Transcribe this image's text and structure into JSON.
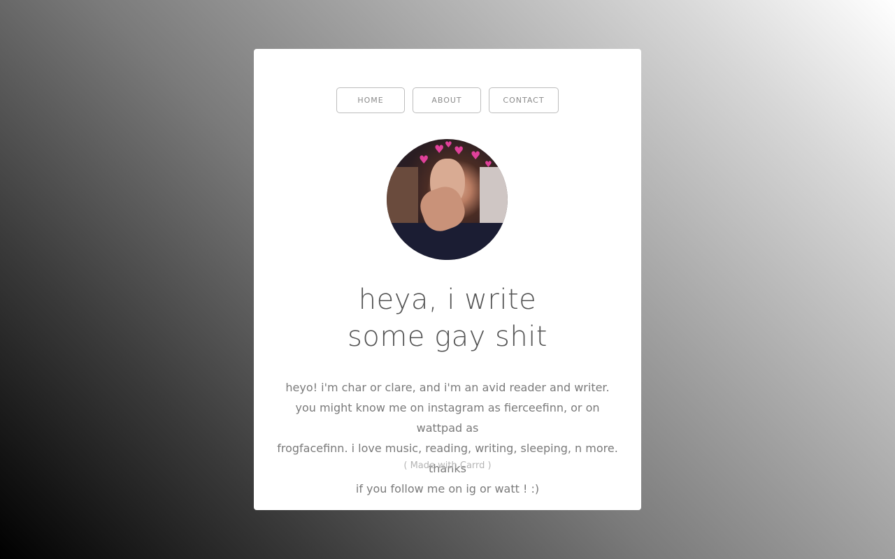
{
  "nav": {
    "home": "HOME",
    "about": "ABOUT",
    "contact": "CONTACT"
  },
  "profile": {
    "headline_line1": "heya, i write",
    "headline_line2": "some gay shit",
    "bio_lines": [
      "heyo! i'm char or clare, and i'm an avid reader and writer.",
      "you might know me on instagram as fierceefinn, or on wattpad as",
      "frogfacefinn. i love music, reading, writing, sleeping, n more. thanks",
      "if you follow me on ig or watt ! :)"
    ]
  },
  "footer": {
    "credit": "( Made with Carrd )"
  },
  "colors": {
    "card_bg": "#ffffff",
    "heart": "#e0419a",
    "text": "#7a7a7a"
  }
}
